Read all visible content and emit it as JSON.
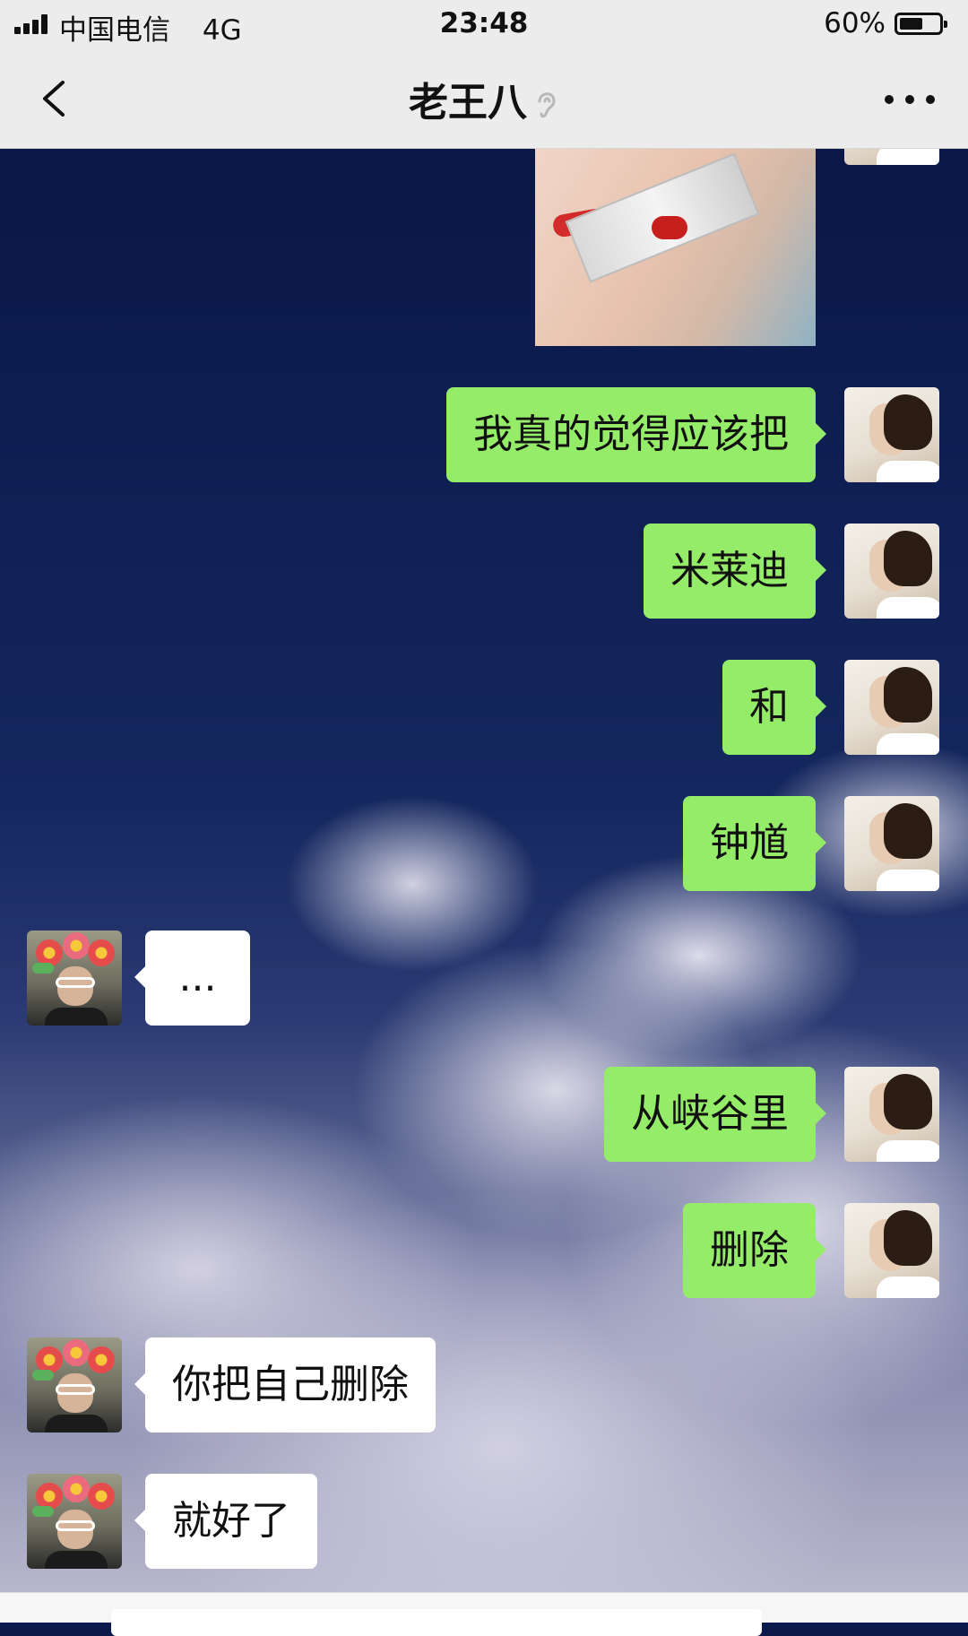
{
  "status_bar": {
    "carrier": "中国电信",
    "network": "4G",
    "time": "23:48",
    "battery_percent": "60%",
    "battery_level": 0.6
  },
  "nav": {
    "title": "老王八",
    "icons": {
      "back": "chevron-left-icon",
      "mute": "ear-icon",
      "more": "more-dots-icon"
    }
  },
  "messages": [
    {
      "sender": "me",
      "type": "image"
    },
    {
      "sender": "me",
      "type": "text",
      "text": "我真的觉得应该把"
    },
    {
      "sender": "me",
      "type": "text",
      "text": "米莱迪"
    },
    {
      "sender": "me",
      "type": "text",
      "text": "和"
    },
    {
      "sender": "me",
      "type": "text",
      "text": "钟馗"
    },
    {
      "sender": "them",
      "type": "text",
      "text": "..."
    },
    {
      "sender": "me",
      "type": "text",
      "text": "从峡谷里"
    },
    {
      "sender": "me",
      "type": "text",
      "text": "删除"
    },
    {
      "sender": "them",
      "type": "text",
      "text": "你把自己删除"
    },
    {
      "sender": "them",
      "type": "text",
      "text": "就好了"
    }
  ],
  "colors": {
    "my_bubble": "#95ec69",
    "their_bubble": "#ffffff",
    "header_bg": "#ececec",
    "sky_dark": "#0a1747"
  }
}
